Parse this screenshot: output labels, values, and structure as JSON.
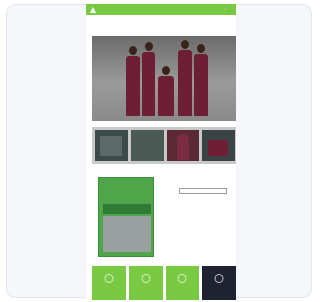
{
  "colors": {
    "brand_green": "#7ac943",
    "maroon": "#6e1f35",
    "dark_tile": "#1f2230"
  },
  "nav": {
    "logo_icon": "leaf-logo-icon",
    "links": [
      "",
      "",
      "",
      "",
      "",
      ""
    ],
    "right": ""
  },
  "hero": {
    "title": ""
  },
  "products": [
    {
      "label": ""
    },
    {
      "label": ""
    },
    {
      "label": ""
    },
    {
      "label": ""
    }
  ],
  "guide": {
    "book_title": "",
    "heading": "",
    "lines": [
      "",
      "",
      "",
      "",
      "",
      ""
    ],
    "button": ""
  },
  "tiles": [
    {
      "label": ""
    },
    {
      "label": ""
    },
    {
      "label": ""
    },
    {
      "label": ""
    }
  ]
}
